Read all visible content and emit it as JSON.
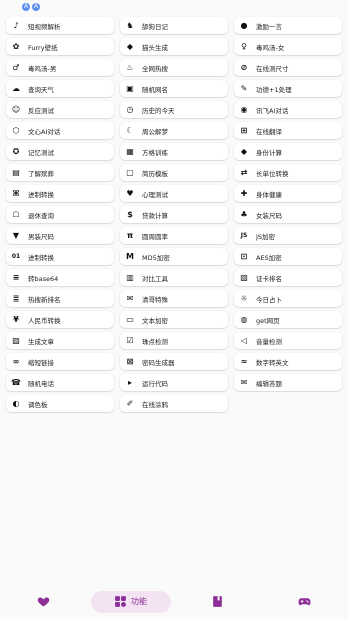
{
  "status": {
    "dot1": "A",
    "dot2": "A"
  },
  "accent_color": "#8b2f97",
  "tabbar": {
    "tabs": [
      {
        "name": "tab-favorites",
        "icon": "heart-icon",
        "label": ""
      },
      {
        "name": "tab-functions",
        "icon": "grid-icon",
        "label": "功能",
        "active": true
      },
      {
        "name": "tab-notes",
        "icon": "note-icon",
        "label": ""
      },
      {
        "name": "tab-games",
        "icon": "gamepad-icon",
        "label": ""
      }
    ]
  },
  "features": [
    {
      "label": "短视频解析",
      "icon": "tiktok-icon"
    },
    {
      "label": "舔狗日记",
      "icon": "dog-icon"
    },
    {
      "label": "激励一言",
      "icon": "bulb-icon"
    },
    {
      "label": "Furry壁纸",
      "icon": "paw-icon"
    },
    {
      "label": "猫头生成",
      "icon": "cat-icon"
    },
    {
      "label": "毒鸡汤-女",
      "icon": "female-icon"
    },
    {
      "label": "毒鸡汤-男",
      "icon": "male-icon"
    },
    {
      "label": "全网热搜",
      "icon": "fire-icon"
    },
    {
      "label": "在线测尺寸",
      "icon": "ruler-icon"
    },
    {
      "label": "查询天气",
      "icon": "weather-icon"
    },
    {
      "label": "随机网名",
      "icon": "name-icon"
    },
    {
      "label": "功德+1处理",
      "icon": "wrench-icon"
    },
    {
      "label": "反应测试",
      "icon": "smile-icon"
    },
    {
      "label": "历史的今天",
      "icon": "clock-icon"
    },
    {
      "label": "讯飞AI对话",
      "icon": "flame-icon"
    },
    {
      "label": "文心AI对话",
      "icon": "cube-icon"
    },
    {
      "label": "周公解梦",
      "icon": "dream-icon"
    },
    {
      "label": "在线翻译",
      "icon": "translate-icon"
    },
    {
      "label": "记忆测试",
      "icon": "brain-icon"
    },
    {
      "label": "方格训练",
      "icon": "grid-square-icon"
    },
    {
      "label": "身份计算",
      "icon": "diamond-icon"
    },
    {
      "label": "了解殡葬",
      "icon": "book-icon"
    },
    {
      "label": "简历模板",
      "icon": "document-icon"
    },
    {
      "label": "长单位转换",
      "icon": "convert-icon"
    },
    {
      "label": "进制转换",
      "icon": "code-icon"
    },
    {
      "label": "心理测试",
      "icon": "heart-icon"
    },
    {
      "label": "身体健康",
      "icon": "health-icon"
    },
    {
      "label": "退休查询",
      "icon": "retire-icon"
    },
    {
      "label": "贷款计算",
      "icon": "money-icon"
    },
    {
      "label": "女装尺码",
      "icon": "dress-icon"
    },
    {
      "label": "男装尺码",
      "icon": "shirt-icon"
    },
    {
      "label": "圆周圆率",
      "icon": "pi-icon"
    },
    {
      "label": "JS加密",
      "icon": "js-icon"
    },
    {
      "label": "进制转换",
      "icon": "binary-icon"
    },
    {
      "label": "MD5加密",
      "icon": "md5-icon"
    },
    {
      "label": "AES加密",
      "icon": "lock-icon"
    },
    {
      "label": "转base64",
      "icon": "base64-icon"
    },
    {
      "label": "对比工具",
      "icon": "compare-icon"
    },
    {
      "label": "证卡排名",
      "icon": "card-icon"
    },
    {
      "label": "热搜新排名",
      "icon": "rank-icon"
    },
    {
      "label": "清哥特殊",
      "icon": "mail-icon"
    },
    {
      "label": "今日占卜",
      "icon": "sun-icon"
    },
    {
      "label": "人民币转换",
      "icon": "rmb-icon"
    },
    {
      "label": "文本加密",
      "icon": "chat-icon"
    },
    {
      "label": "get网页",
      "icon": "web-icon"
    },
    {
      "label": "生成文章",
      "icon": "printer-icon"
    },
    {
      "label": "珠点检测",
      "icon": "checkbox-icon"
    },
    {
      "label": "音量检测",
      "icon": "volume-icon"
    },
    {
      "label": "缩短链接",
      "icon": "link-icon"
    },
    {
      "label": "密码生成器",
      "icon": "password-icon"
    },
    {
      "label": "数字转英文",
      "icon": "numbers-icon"
    },
    {
      "label": "随机电话",
      "icon": "phone-icon"
    },
    {
      "label": "运行代码",
      "icon": "terminal-icon"
    },
    {
      "label": "编辑答题",
      "icon": "edit-icon"
    },
    {
      "label": "调色板",
      "icon": "palette-icon"
    },
    {
      "label": "在线涂鸦",
      "icon": "brush-icon"
    }
  ]
}
